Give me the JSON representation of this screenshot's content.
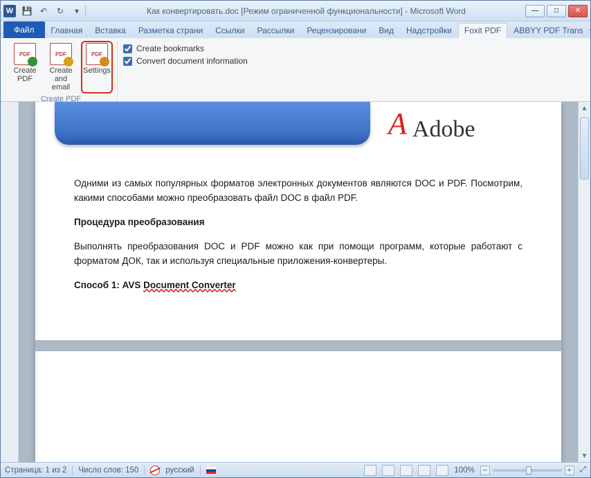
{
  "title": "Как конвертировать.doc [Режим ограниченной функциональности]  -  Microsoft Word",
  "qat": {
    "save": "💾",
    "undo": "↶",
    "redo": "↻",
    "more": "▾"
  },
  "tabs": {
    "file": "Файл",
    "items": [
      "Главная",
      "Вставка",
      "Разметка страни",
      "Ссылки",
      "Рассылки",
      "Рецензировани",
      "Вид",
      "Надстройки",
      "Foxit PDF",
      "ABBYY PDF Trans"
    ],
    "activeIndex": 8
  },
  "ribbon": {
    "createPdf": "Create\nPDF",
    "createEmail": "Create\nand email",
    "settings": "Settings",
    "groupLabel": "Create PDF",
    "chkBookmarks": "Create bookmarks",
    "chkDocInfo": "Convert document information"
  },
  "adobe": "Adobe",
  "doc": {
    "p1": "Одними из самых популярных форматов электронных документов являются DOC и PDF. Посмотрим, какими способами можно преобразовать файл DOC в файл PDF.",
    "h1": "Процедура преобразования",
    "p2": "Выполнять преобразования DOC и PDF можно как при помощи программ, которые работают с форматом ДОК, так и используя специальные приложения-конвертеры.",
    "h2a": "Способ 1: AVS ",
    "h2b": "Document Converter"
  },
  "status": {
    "page": "Страница: 1 из 2",
    "words": "Число слов: 150",
    "lang": "русский",
    "zoom": "100%"
  },
  "glyph": {
    "min": "—",
    "max": "□",
    "close": "✕",
    "up": "▲",
    "down": "▼",
    "caret": "ˇ",
    "plus": "+",
    "minus": "−",
    "expand": "⤢"
  }
}
